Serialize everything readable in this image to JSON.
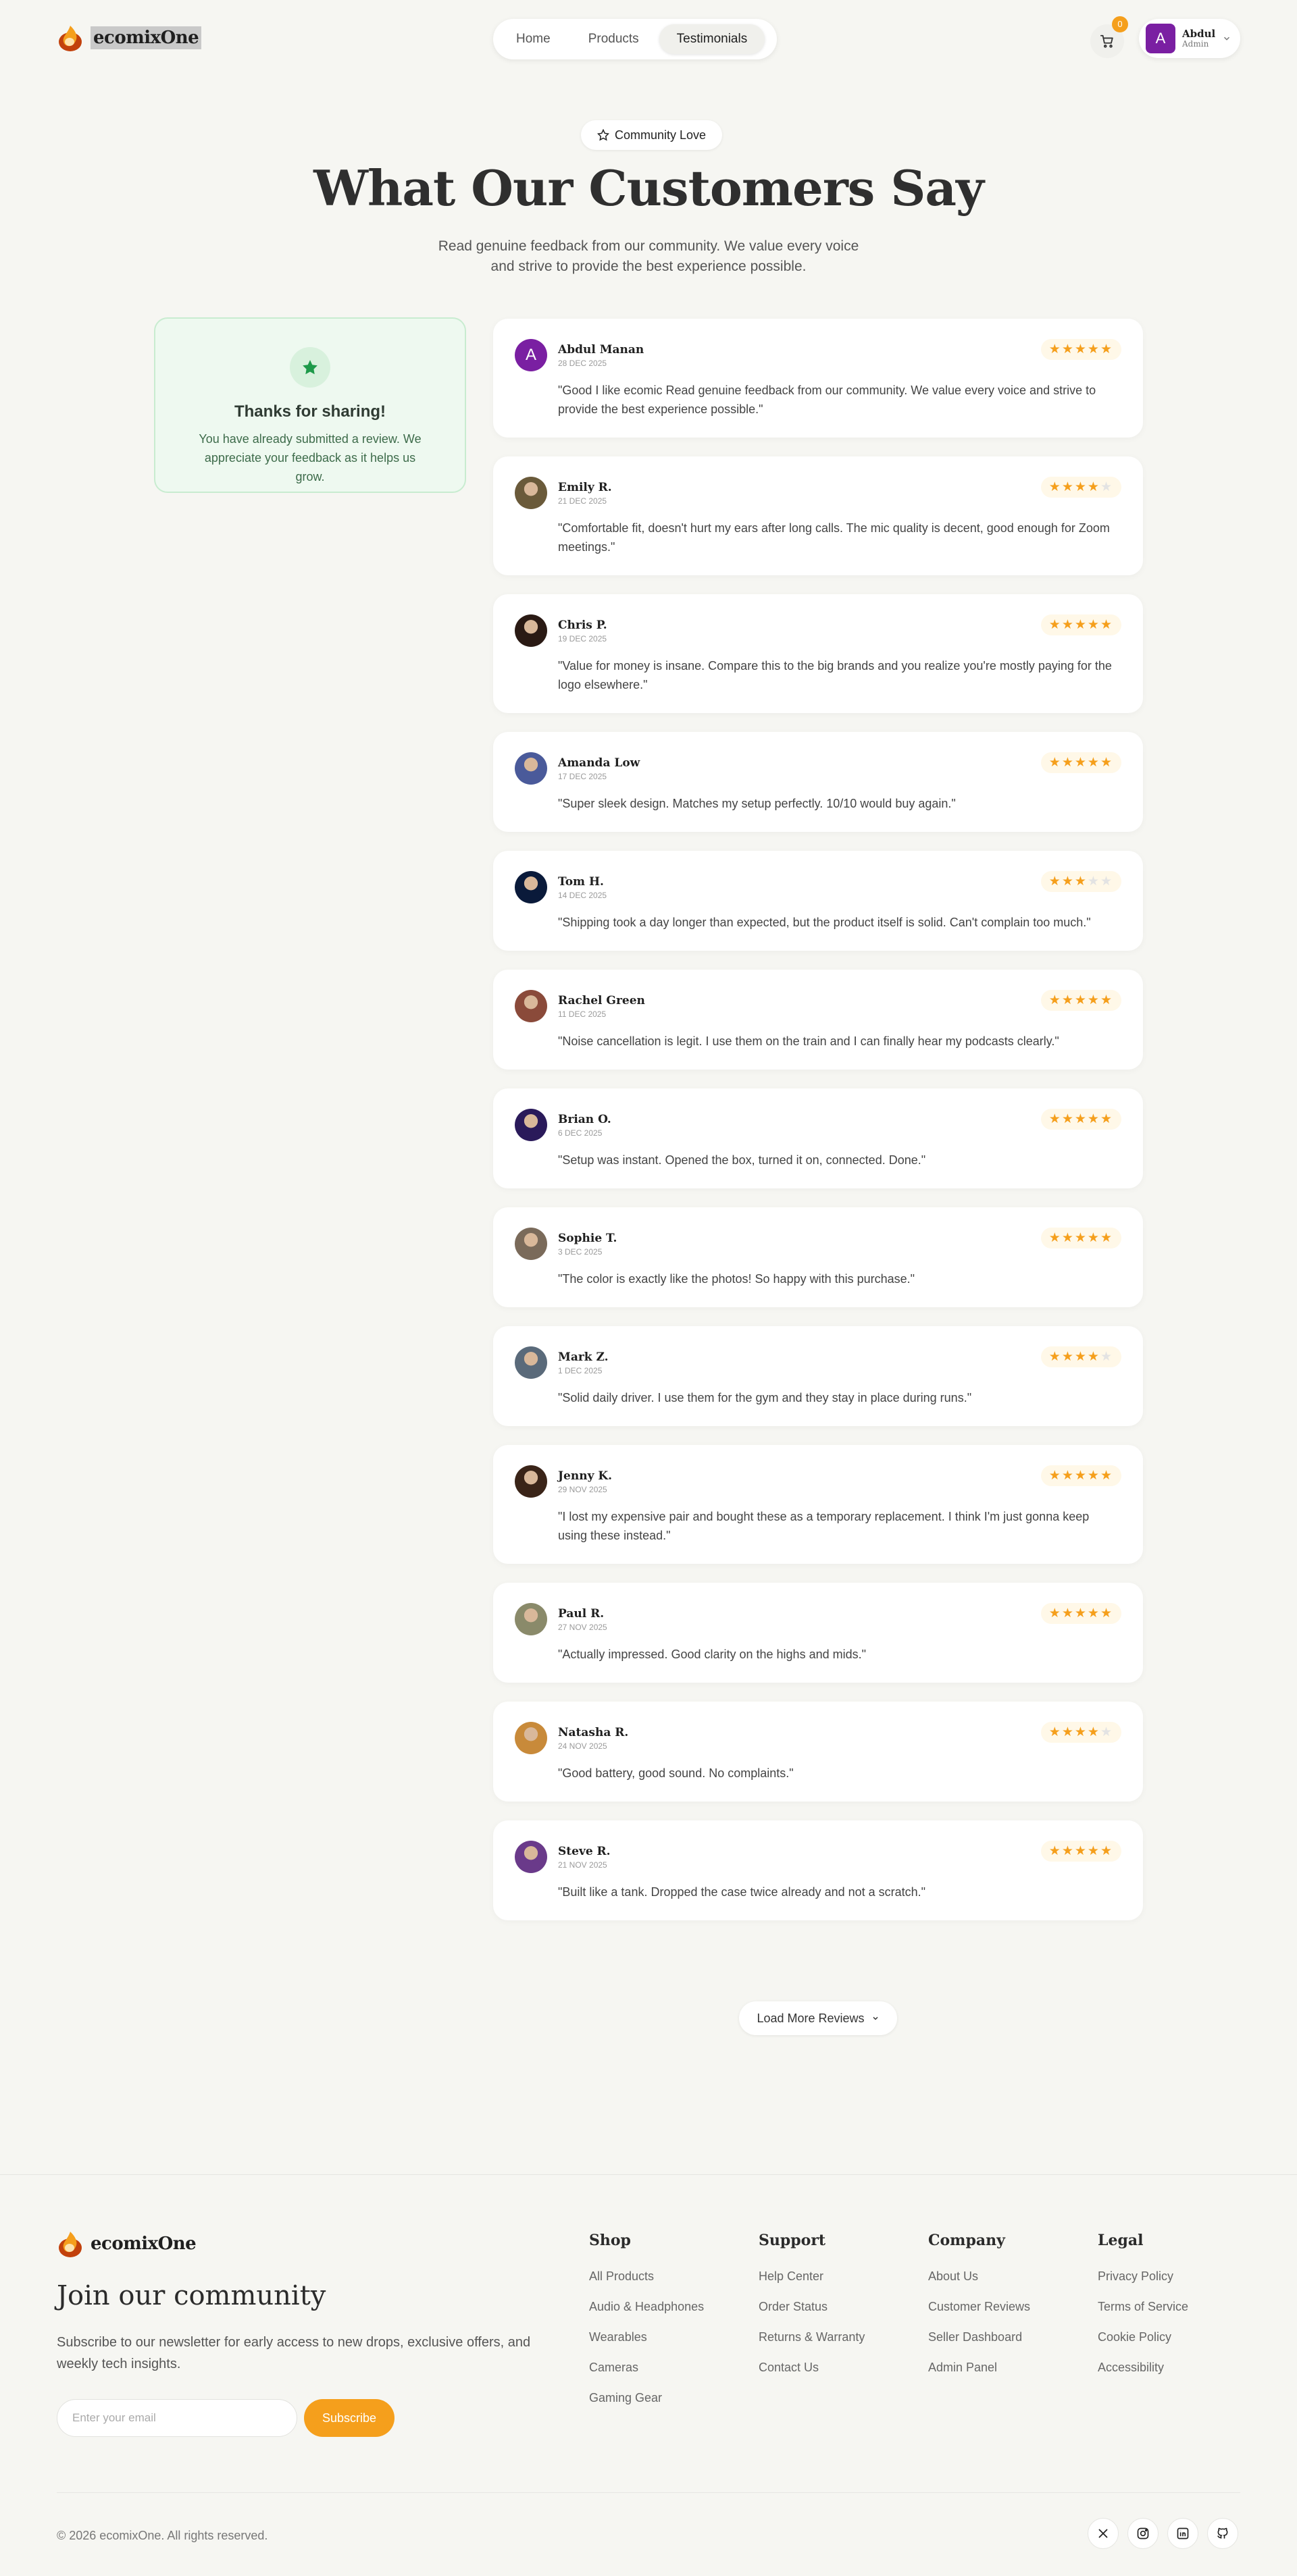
{
  "brand": {
    "name": "ecomixOne"
  },
  "nav": {
    "items": [
      {
        "label": "Home",
        "active": false
      },
      {
        "label": "Products",
        "active": false
      },
      {
        "label": "Testimonials",
        "active": true
      }
    ]
  },
  "cart": {
    "count": "0",
    "icon": "cart-icon"
  },
  "user": {
    "initial": "A",
    "name": "Abdul",
    "role": "Admin"
  },
  "hero": {
    "badge": "Community Love",
    "title": "What Our Customers Say",
    "subtitle": "Read genuine feedback from our community. We value every voice and strive to provide the best experience possible."
  },
  "thanks": {
    "title": "Thanks for sharing!",
    "text": "You have already submitted a review. We appreciate your feedback as it helps us grow."
  },
  "reviews": [
    {
      "name": "Abdul Manan",
      "date": "28 DEC 2025",
      "rating": 5,
      "initial": "A",
      "avatar_color": "#7a1fa2",
      "text": "\"Good I like ecomic Read genuine feedback from our community. We value every voice and strive to provide the best experience possible.\""
    },
    {
      "name": "Emily R.",
      "date": "21 DEC 2025",
      "rating": 4,
      "avatar_color": "#6a5a3a",
      "text": "\"Comfortable fit, doesn't hurt my ears after long calls. The mic quality is decent, good enough for Zoom meetings.\""
    },
    {
      "name": "Chris P.",
      "date": "19 DEC 2025",
      "rating": 5,
      "avatar_color": "#2a1a14",
      "text": "\"Value for money is insane. Compare this to the big brands and you realize you're mostly paying for the logo elsewhere.\""
    },
    {
      "name": "Amanda Low",
      "date": "17 DEC 2025",
      "rating": 5,
      "avatar_color": "#4a5a9a",
      "text": "\"Super sleek design. Matches my setup perfectly. 10/10 would buy again.\""
    },
    {
      "name": "Tom H.",
      "date": "14 DEC 2025",
      "rating": 3,
      "avatar_color": "#0a1a3a",
      "text": "\"Shipping took a day longer than expected, but the product itself is solid. Can't complain too much.\""
    },
    {
      "name": "Rachel Green",
      "date": "11 DEC 2025",
      "rating": 5,
      "avatar_color": "#8a4a3a",
      "text": "\"Noise cancellation is legit. I use them on the train and I can finally hear my podcasts clearly.\""
    },
    {
      "name": "Brian O.",
      "date": "6 DEC 2025",
      "rating": 5,
      "avatar_color": "#2a1a5a",
      "text": "\"Setup was instant. Opened the box, turned it on, connected. Done.\""
    },
    {
      "name": "Sophie T.",
      "date": "3 DEC 2025",
      "rating": 5,
      "avatar_color": "#7a6a5a",
      "text": "\"The color is exactly like the photos! So happy with this purchase.\""
    },
    {
      "name": "Mark Z.",
      "date": "1 DEC 2025",
      "rating": 4,
      "avatar_color": "#5a6a7a",
      "text": "\"Solid daily driver. I use them for the gym and they stay in place during runs.\""
    },
    {
      "name": "Jenny K.",
      "date": "29 NOV 2025",
      "rating": 5,
      "avatar_color": "#3a2418",
      "text": "\"I lost my expensive pair and bought these as a temporary replacement. I think I'm just gonna keep using these instead.\""
    },
    {
      "name": "Paul R.",
      "date": "27 NOV 2025",
      "rating": 5,
      "avatar_color": "#8a8a6a",
      "text": "\"Actually impressed. Good clarity on the highs and mids.\""
    },
    {
      "name": "Natasha R.",
      "date": "24 NOV 2025",
      "rating": 4,
      "avatar_color": "#c88a3a",
      "text": "\"Good battery, good sound. No complaints.\""
    },
    {
      "name": "Steve R.",
      "date": "21 NOV 2025",
      "rating": 5,
      "avatar_color": "#6a3a8a",
      "text": "\"Built like a tank. Dropped the case twice already and not a scratch.\""
    }
  ],
  "load_more": "Load More Reviews",
  "footer": {
    "join_title": "Join our community",
    "join_desc": "Subscribe to our newsletter for early access to new drops, exclusive offers, and weekly tech insights.",
    "email_placeholder": "Enter your email",
    "subscribe": "Subscribe",
    "columns": [
      {
        "title": "Shop",
        "links": [
          "All Products",
          "Audio & Headphones",
          "Wearables",
          "Cameras",
          "Gaming Gear"
        ]
      },
      {
        "title": "Support",
        "links": [
          "Help Center",
          "Order Status",
          "Returns & Warranty",
          "Contact Us"
        ]
      },
      {
        "title": "Company",
        "links": [
          "About Us",
          "Customer Reviews",
          "Seller Dashboard",
          "Admin Panel"
        ]
      },
      {
        "title": "Legal",
        "links": [
          "Privacy Policy",
          "Terms of Service",
          "Cookie Policy",
          "Accessibility"
        ]
      }
    ],
    "copyright": "© 2026 ecomixOne. All rights reserved.",
    "social": [
      "x-icon",
      "instagram-icon",
      "linkedin-icon",
      "github-icon"
    ]
  },
  "colors": {
    "accent": "#f59f1c",
    "background": "#f6f6f2",
    "success": "#1e9a4a"
  }
}
